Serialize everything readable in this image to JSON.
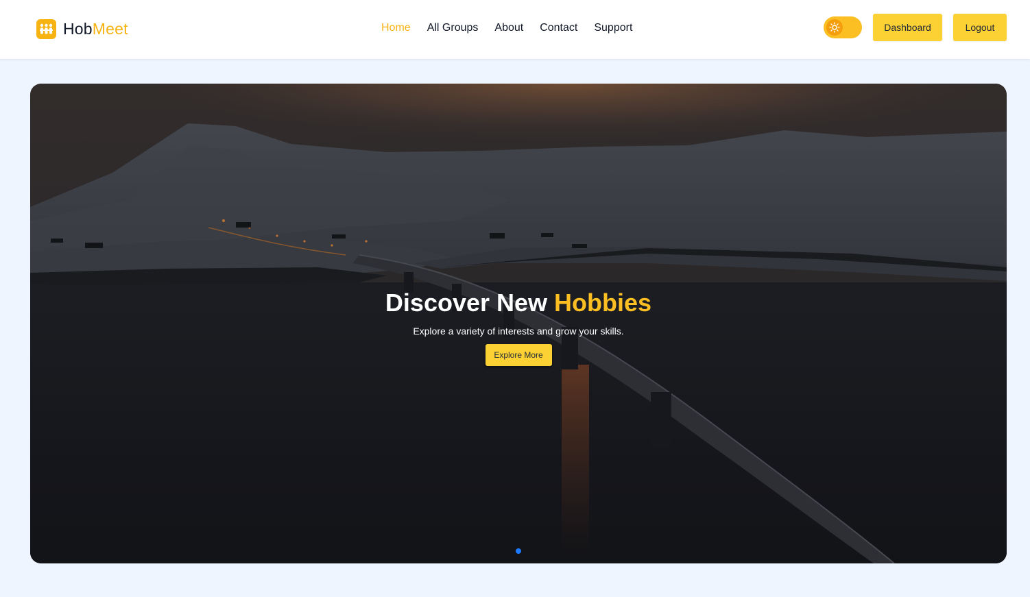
{
  "brand": {
    "name_part1": "Hob",
    "name_part2": "Meet",
    "accent_color": "#f6b312",
    "icon": "people-group-icon"
  },
  "nav": {
    "items": [
      {
        "label": "Home",
        "active": true
      },
      {
        "label": "All Groups",
        "active": false
      },
      {
        "label": "About",
        "active": false
      },
      {
        "label": "Contact",
        "active": false
      },
      {
        "label": "Support",
        "active": false
      }
    ]
  },
  "header_actions": {
    "theme_toggle_icon": "sun-icon",
    "dashboard_label": "Dashboard",
    "logout_label": "Logout",
    "button_color": "#fcd133"
  },
  "hero": {
    "title_part1": "Discover New ",
    "title_part2": "Hobbies",
    "subtitle": "Explore a variety of interests and grow your skills.",
    "cta_label": "Explore More",
    "slides_count": 1,
    "active_slide": 1,
    "dot_color": "#1e7bff"
  },
  "colors": {
    "page_bg": "#eff5fe",
    "navbar_bg": "#ffffff"
  }
}
